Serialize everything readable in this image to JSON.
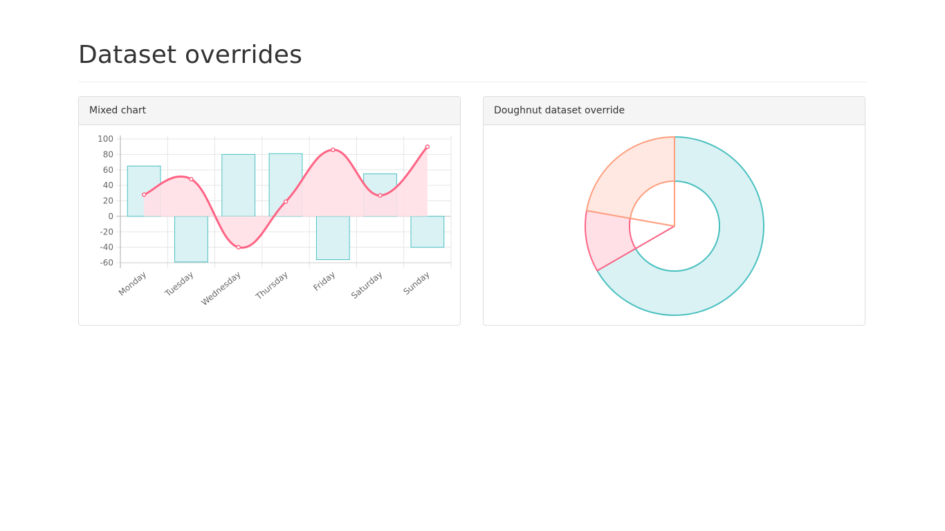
{
  "page": {
    "title": "Dataset overrides"
  },
  "panels": [
    {
      "title": "Mixed chart"
    },
    {
      "title": "Doughnut dataset override"
    }
  ],
  "chart_data": [
    {
      "type": "bar",
      "subtype": "mixed-bar-line",
      "title": "Mixed chart",
      "categories": [
        "Monday",
        "Tuesday",
        "Wednesday",
        "Thursday",
        "Friday",
        "Saturday",
        "Sunday"
      ],
      "ylim": [
        -60,
        100
      ],
      "yticks": [
        100,
        80,
        60,
        40,
        20,
        0,
        -20,
        -40,
        -60
      ],
      "grid": true,
      "legend": "none",
      "series": [
        {
          "type": "bar",
          "values": [
            65,
            -59,
            80,
            81,
            -56,
            55,
            -40
          ],
          "color": "#4bc0c0",
          "fill": "#dbf2f4"
        },
        {
          "type": "line",
          "curve": "smooth",
          "filled": true,
          "values": [
            28,
            48,
            -40,
            19,
            86,
            27,
            90
          ],
          "color": "#ff6384",
          "fill": "#ffe0e7"
        }
      ]
    },
    {
      "type": "pie",
      "subtype": "doughnut",
      "title": "Doughnut dataset override",
      "legend": "none",
      "series": [
        {
          "ring": "outer",
          "values": [
            300,
            50,
            100
          ],
          "colors": [
            "#4bc0c0",
            "#ff6384",
            "#ff9f7f"
          ],
          "fills": [
            "#dbf2f4",
            "#ffe0e7",
            "#ffe8e2"
          ]
        },
        {
          "ring": "inner",
          "values": [
            300,
            50,
            100
          ],
          "colors": [
            "#4bc0c0",
            "#ff6384",
            "#ff9f7f"
          ],
          "fills": [
            "#ffffff",
            "#ffffff",
            "#ffffff"
          ]
        }
      ]
    }
  ]
}
